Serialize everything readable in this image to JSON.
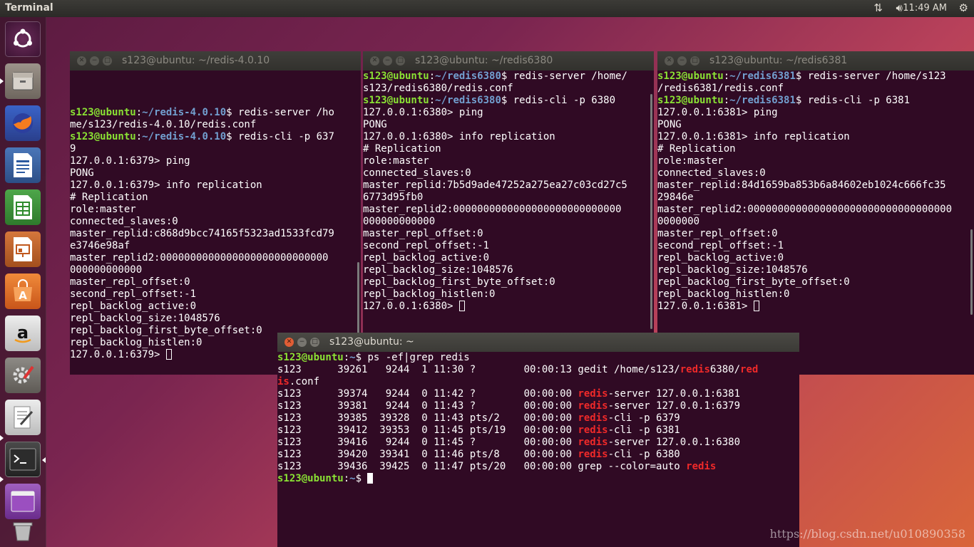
{
  "topbar": {
    "app_name": "Terminal",
    "clock": "11:49 AM",
    "network_icon": "network-updown-icon",
    "volume_icon": "volume-icon",
    "settings_icon": "gear-icon"
  },
  "launcher": [
    "ubuntu-dash-icon",
    "files-icon",
    "firefox-icon",
    "libreoffice-writer-icon",
    "libreoffice-calc-icon",
    "libreoffice-impress-icon",
    "software-center-icon",
    "amazon-icon",
    "system-settings-icon",
    "text-editor-icon",
    "terminal-icon",
    "window-icon",
    "trash-icon"
  ],
  "windows": {
    "w1": {
      "title": "s123@ubuntu: ~/redis-4.0.10",
      "lines": [
        "",
        "",
        "",
        [
          {
            "t": "s123@ubuntu",
            "c": "pu"
          },
          {
            "t": ":",
            "c": ""
          },
          {
            "t": "~/redis-4.0.10",
            "c": "pp"
          },
          {
            "t": "$ redis-server /ho",
            "c": ""
          }
        ],
        "me/s123/redis-4.0.10/redis.conf",
        [
          {
            "t": "s123@ubuntu",
            "c": "pu"
          },
          {
            "t": ":",
            "c": ""
          },
          {
            "t": "~/redis-4.0.10",
            "c": "pp"
          },
          {
            "t": "$ redis-cli -p 637",
            "c": ""
          }
        ],
        "9",
        "127.0.0.1:6379> ping",
        "PONG",
        "127.0.0.1:6379> info replication",
        "# Replication",
        "role:master",
        "connected_slaves:0",
        "master_replid:c868d9bcc74165f5323ad1533fcd79",
        "e3746e98af",
        "master_replid2:0000000000000000000000000000",
        "000000000000",
        "master_repl_offset:0",
        "second_repl_offset:-1",
        "repl_backlog_active:0",
        "repl_backlog_size:1048576",
        "repl_backlog_first_byte_offset:0",
        "repl_backlog_histlen:0",
        [
          {
            "t": "127.0.0.1:6379> ",
            "c": ""
          },
          {
            "cursor": "hollow"
          }
        ]
      ]
    },
    "w2": {
      "title": "s123@ubuntu: ~/redis6380",
      "lines": [
        [
          {
            "t": "s123@ubuntu",
            "c": "pu"
          },
          {
            "t": ":",
            "c": ""
          },
          {
            "t": "~/redis6380",
            "c": "pp"
          },
          {
            "t": "$ redis-server /home/",
            "c": ""
          }
        ],
        "s123/redis6380/redis.conf",
        [
          {
            "t": "s123@ubuntu",
            "c": "pu"
          },
          {
            "t": ":",
            "c": ""
          },
          {
            "t": "~/redis6380",
            "c": "pp"
          },
          {
            "t": "$ redis-cli -p 6380",
            "c": ""
          }
        ],
        "127.0.0.1:6380> ping",
        "PONG",
        "127.0.0.1:6380> info replication",
        "# Replication",
        "role:master",
        "connected_slaves:0",
        "master_replid:7b5d9ade47252a275ea27c03cd27c5",
        "6773d95fb0",
        "master_replid2:0000000000000000000000000000",
        "000000000000",
        "master_repl_offset:0",
        "second_repl_offset:-1",
        "repl_backlog_active:0",
        "repl_backlog_size:1048576",
        "repl_backlog_first_byte_offset:0",
        "repl_backlog_histlen:0",
        [
          {
            "t": "127.0.0.1:6380> ",
            "c": ""
          },
          {
            "cursor": "hollow"
          }
        ]
      ]
    },
    "w3": {
      "title": "s123@ubuntu: ~/redis6381",
      "lines": [
        [
          {
            "t": "s123@ubuntu",
            "c": "pu"
          },
          {
            "t": ":",
            "c": ""
          },
          {
            "t": "~/redis6381",
            "c": "pp"
          },
          {
            "t": "$ redis-server /home/s123",
            "c": ""
          }
        ],
        "/redis6381/redis.conf",
        [
          {
            "t": "s123@ubuntu",
            "c": "pu"
          },
          {
            "t": ":",
            "c": ""
          },
          {
            "t": "~/redis6381",
            "c": "pp"
          },
          {
            "t": "$ redis-cli -p 6381",
            "c": ""
          }
        ],
        "127.0.0.1:6381> ping",
        "PONG",
        "127.0.0.1:6381> info replication",
        "# Replication",
        "role:master",
        "connected_slaves:0",
        "master_replid:84d1659ba853b6a84602eb1024c666fc35",
        "29846e",
        "master_replid2:0000000000000000000000000000000000",
        "0000000",
        "master_repl_offset:0",
        "second_repl_offset:-1",
        "repl_backlog_active:0",
        "repl_backlog_size:1048576",
        "repl_backlog_first_byte_offset:0",
        "repl_backlog_histlen:0",
        [
          {
            "t": "127.0.0.1:6381> ",
            "c": ""
          },
          {
            "cursor": "hollow"
          }
        ]
      ]
    },
    "w4": {
      "title": "s123@ubuntu: ~",
      "lines": [
        [
          {
            "t": "s123@ubuntu",
            "c": "pu"
          },
          {
            "t": ":",
            "c": ""
          },
          {
            "t": "~",
            "c": "pp"
          },
          {
            "t": "$ ps -ef|grep redis",
            "c": ""
          }
        ],
        [
          {
            "t": "s123      39261   9244  1 11:30 ?        00:00:13 gedit /home/s123/",
            "c": ""
          },
          {
            "t": "redis",
            "c": "hl"
          },
          {
            "t": "6380/",
            "c": ""
          },
          {
            "t": "red",
            "c": "hl"
          }
        ],
        [
          {
            "t": "is",
            "c": "hl"
          },
          {
            "t": ".conf",
            "c": ""
          }
        ],
        [
          {
            "t": "s123      39374   9244  0 11:42 ?        00:00:00 ",
            "c": ""
          },
          {
            "t": "redis",
            "c": "hl"
          },
          {
            "t": "-server 127.0.0.1:6381",
            "c": ""
          }
        ],
        [
          {
            "t": "s123      39381   9244  0 11:43 ?        00:00:00 ",
            "c": ""
          },
          {
            "t": "redis",
            "c": "hl"
          },
          {
            "t": "-server 127.0.0.1:6379",
            "c": ""
          }
        ],
        [
          {
            "t": "s123      39385  39328  0 11:43 pts/2    00:00:00 ",
            "c": ""
          },
          {
            "t": "redis",
            "c": "hl"
          },
          {
            "t": "-cli -p 6379",
            "c": ""
          }
        ],
        [
          {
            "t": "s123      39412  39353  0 11:45 pts/19   00:00:00 ",
            "c": ""
          },
          {
            "t": "redis",
            "c": "hl"
          },
          {
            "t": "-cli -p 6381",
            "c": ""
          }
        ],
        [
          {
            "t": "s123      39416   9244  0 11:45 ?        00:00:00 ",
            "c": ""
          },
          {
            "t": "redis",
            "c": "hl"
          },
          {
            "t": "-server 127.0.0.1:6380",
            "c": ""
          }
        ],
        [
          {
            "t": "s123      39420  39341  0 11:46 pts/8    00:00:00 ",
            "c": ""
          },
          {
            "t": "redis",
            "c": "hl"
          },
          {
            "t": "-cli -p 6380",
            "c": ""
          }
        ],
        [
          {
            "t": "s123      39436  39425  0 11:47 pts/20   00:00:00 grep --color=auto ",
            "c": ""
          },
          {
            "t": "redis",
            "c": "hl"
          }
        ],
        [
          {
            "t": "s123@ubuntu",
            "c": "pu"
          },
          {
            "t": ":",
            "c": ""
          },
          {
            "t": "~",
            "c": "pp"
          },
          {
            "t": "$ ",
            "c": ""
          },
          {
            "cursor": "solid"
          }
        ]
      ]
    }
  },
  "watermark": "https://blog.csdn.net/u010890358"
}
